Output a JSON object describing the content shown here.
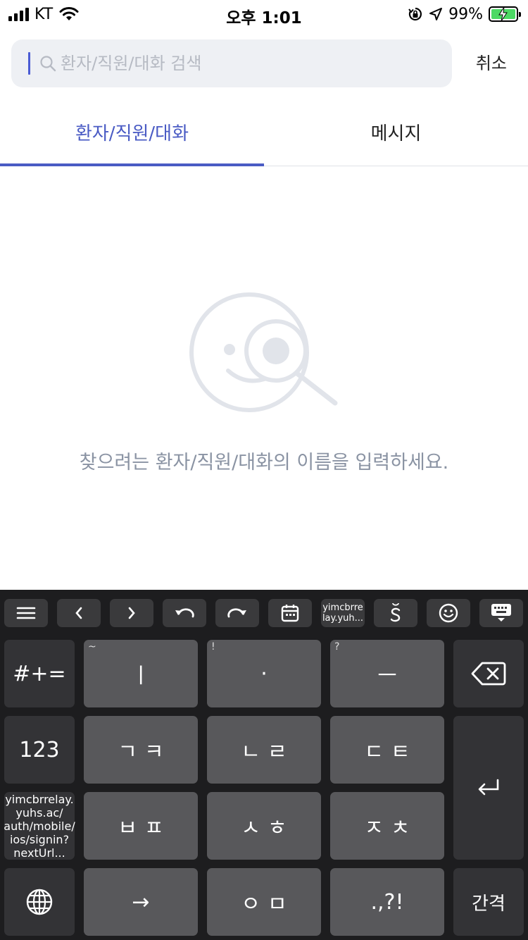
{
  "status_bar": {
    "carrier": "KT",
    "time": "오후 1:01",
    "battery": "99%"
  },
  "search": {
    "placeholder": "환자/직원/대화 검색",
    "cancel_label": "취소"
  },
  "tabs": [
    {
      "label": "환자/직원/대화",
      "active": true
    },
    {
      "label": "메시지",
      "active": false
    }
  ],
  "empty_state": {
    "message": "찾으려는 환자/직원/대화의 이름을 입력하세요."
  },
  "keyboard": {
    "toolbar": {
      "url_short": "yimcbrrelay.yuh...",
      "url_line1": "yimcbrre",
      "url_line2": "lay.yuh..."
    },
    "rows": [
      {
        "side": "#+=",
        "keys": [
          {
            "hint": "~",
            "label": "ㅣ"
          },
          {
            "hint": "!",
            "label": "·"
          },
          {
            "hint": "?",
            "label": "ㅡ"
          }
        ]
      },
      {
        "side": "123",
        "keys": [
          {
            "label": "ㄱㅋ"
          },
          {
            "label": "ㄴㄹ"
          },
          {
            "label": "ㄷㅌ"
          }
        ]
      },
      {
        "side": "yimcbrrelay.yuhs.ac/auth/mobile/ios/signin?nextUrl...",
        "side_lines": [
          "yimcbrrelay.",
          "yuhs.ac/",
          "auth/mobile/",
          "ios/signin?",
          "nextUrl..."
        ],
        "keys": [
          {
            "label": "ㅂㅍ"
          },
          {
            "label": "ㅅㅎ"
          },
          {
            "label": "ㅈㅊ"
          }
        ]
      },
      {
        "keys": [
          {
            "label": "→"
          },
          {
            "label": "ㅇㅁ"
          },
          {
            "label": ".,?!"
          }
        ]
      }
    ],
    "space_label": "간격"
  }
}
